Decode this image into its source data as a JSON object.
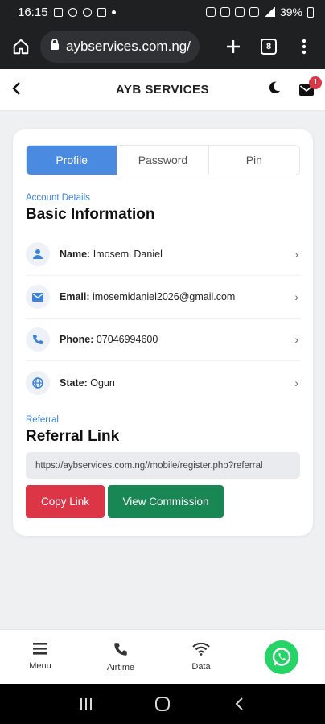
{
  "status_bar": {
    "time": "16:15",
    "battery": "39%"
  },
  "browser": {
    "url": "aybservices.com.ng/",
    "tab_count": "8"
  },
  "header": {
    "title": "AYB SERVICES",
    "notification_count": "1"
  },
  "profile": {
    "tabs": [
      {
        "label": "Profile",
        "active": true
      },
      {
        "label": "Password",
        "active": false
      },
      {
        "label": "Pin",
        "active": false
      }
    ],
    "account_label": "Account Details",
    "section_title": "Basic Information",
    "fields": [
      {
        "icon": "user-icon",
        "label": "Name:",
        "value": "Imosemi Daniel"
      },
      {
        "icon": "envelope-icon",
        "label": "Email:",
        "value": "imosemidaniel2026@gmail.com"
      },
      {
        "icon": "phone-icon",
        "label": "Phone:",
        "value": "07046994600"
      },
      {
        "icon": "globe-icon",
        "label": "State:",
        "value": "Ogun"
      }
    ],
    "referral_label": "Referral",
    "referral_title": "Referral Link",
    "referral_url": "https://aybservices.com.ng//mobile/register.php?referral",
    "copy_button": "Copy Link",
    "commission_button": "View Commission"
  },
  "bottom_nav": [
    {
      "icon": "menu-icon",
      "label": "Menu"
    },
    {
      "icon": "phone-icon",
      "label": "Airtime"
    },
    {
      "icon": "wifi-icon",
      "label": "Data"
    }
  ],
  "colors": {
    "primary": "#4a8ae0",
    "accent_text": "#3b82d8",
    "danger": "#dc3545",
    "success": "#198754",
    "whatsapp": "#25d366"
  }
}
